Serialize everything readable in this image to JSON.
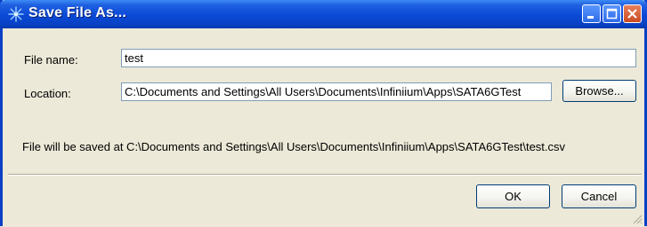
{
  "window": {
    "title": "Save File As...",
    "accent": "#0a49d6"
  },
  "form": {
    "file_name_label": "File name:",
    "file_name_value": "test",
    "location_label": "Location:",
    "location_value": "C:\\Documents and Settings\\All Users\\Documents\\Infiniium\\Apps\\SATA6GTest",
    "browse_label": "Browse...",
    "info_text": "File will be saved at C:\\Documents and Settings\\All Users\\Documents\\Infiniium\\Apps\\SATA6GTest\\test.csv"
  },
  "buttons": {
    "ok_label": "OK",
    "cancel_label": "Cancel"
  },
  "icons": {
    "title": "agilent-spark-icon",
    "minimize": "minimize-icon",
    "maximize": "maximize-icon",
    "close": "close-icon",
    "resize": "resize-grip-icon"
  }
}
